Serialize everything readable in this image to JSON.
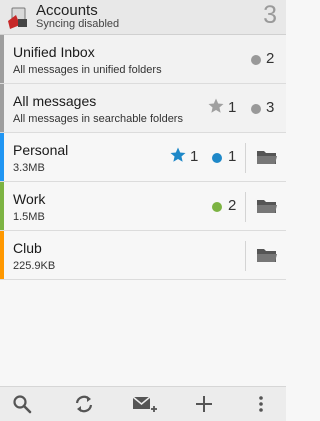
{
  "header": {
    "title": "Accounts",
    "subtitle": "Syncing disabled",
    "total_count": "3"
  },
  "rows": [
    {
      "name": "Unified Inbox",
      "sub": "All messages in unified folders",
      "bar_color": "#9e9e9e",
      "unread_count": "2",
      "dot_color": "#999999"
    },
    {
      "name": "All messages",
      "sub": "All messages in searchable folders",
      "bar_color": "#9e9e9e",
      "star_count": "1",
      "star_color": "#a0a0a0",
      "unread_count": "3",
      "dot_color": "#999999"
    },
    {
      "name": "Personal",
      "sub": "3.3MB",
      "bar_color": "#2196f3",
      "star_count": "1",
      "star_color": "#1e88c8",
      "unread_count": "1",
      "dot_color": "#1e88c8"
    },
    {
      "name": "Work",
      "sub": "1.5MB",
      "bar_color": "#7cb342",
      "unread_count": "2",
      "dot_color": "#7cb342"
    },
    {
      "name": "Club",
      "sub": "225.9KB",
      "bar_color": "#ff9800"
    }
  ],
  "bottom_bar": {
    "icons": [
      "search-icon",
      "refresh-icon",
      "compose-icon",
      "add-icon",
      "overflow-menu-icon"
    ]
  }
}
